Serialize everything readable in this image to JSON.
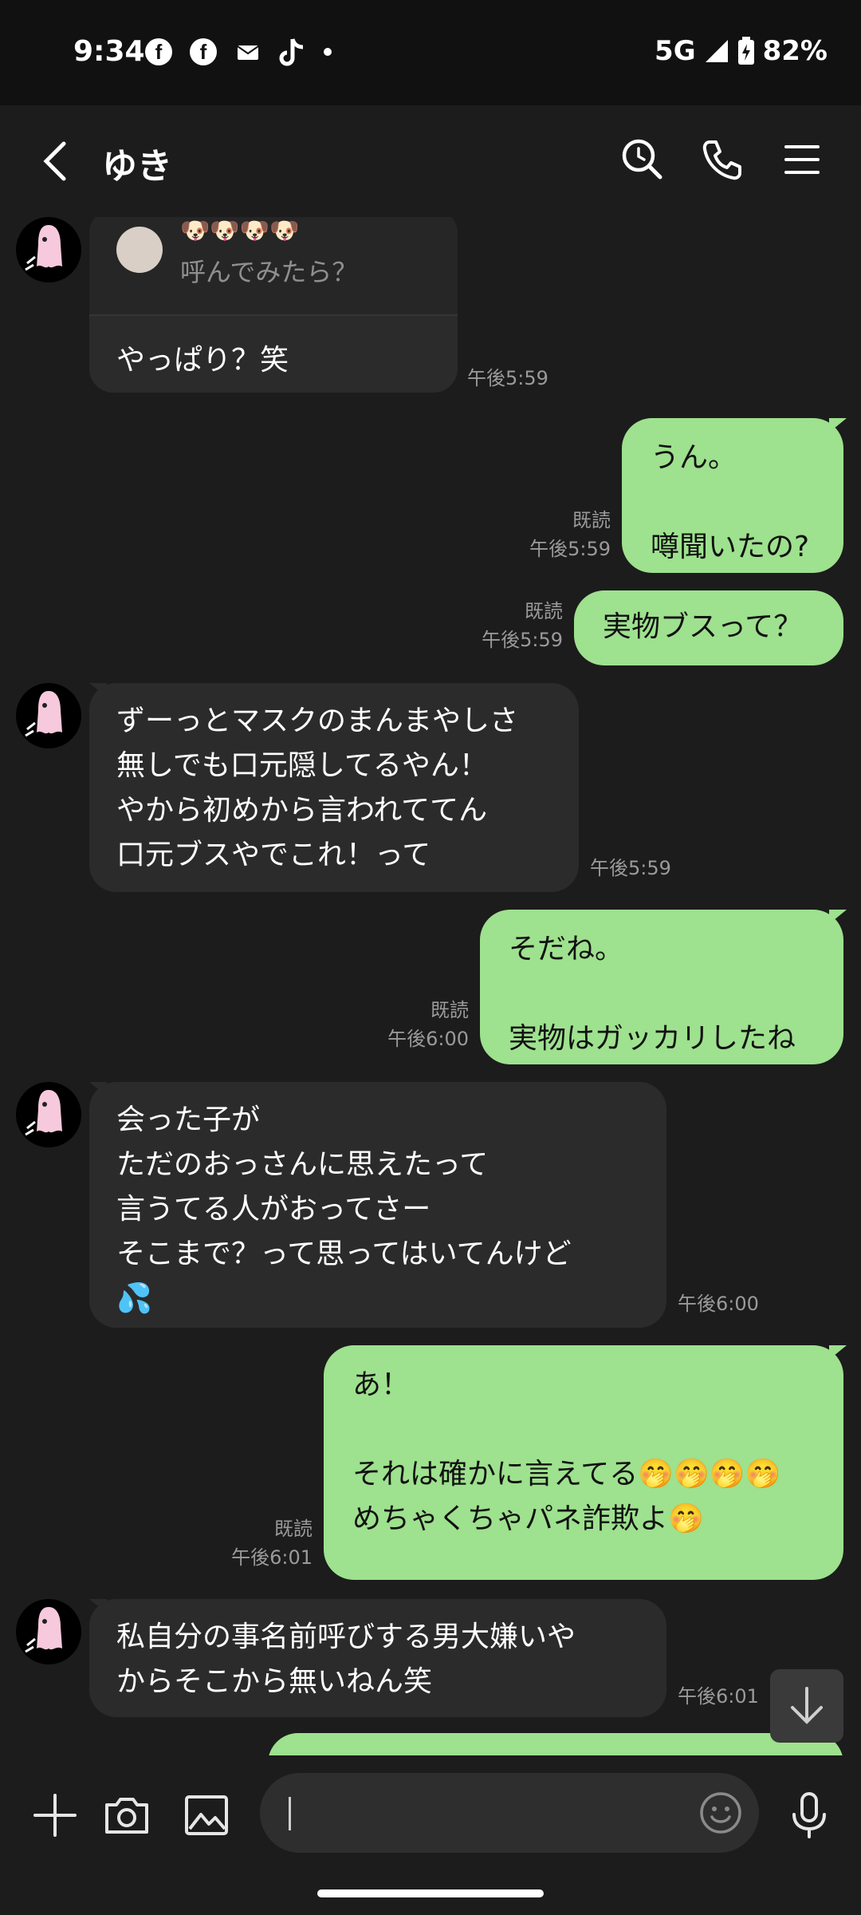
{
  "status_bar": {
    "time": "9:34",
    "network": "5G",
    "battery": "82%",
    "notification_icons": [
      "facebook-icon",
      "facebook-icon",
      "mail-icon",
      "tiktok-icon"
    ]
  },
  "header": {
    "title": "ゆき",
    "icons": [
      "back-icon",
      "search-icon",
      "phone-icon",
      "menu-icon"
    ]
  },
  "messages": [
    {
      "side": "in",
      "reply": {
        "emoji": "🐶🐶🐶🐶",
        "quote": "呼んでみたら？"
      },
      "text": "やっぱり？笑",
      "time": "午後5:59"
    },
    {
      "side": "out",
      "text": "うん。\n\n噂聞いたの?",
      "read": "既読",
      "time": "午後5:59"
    },
    {
      "side": "out",
      "text": "実物ブスって？",
      "read": "既読",
      "time": "午後5:59"
    },
    {
      "side": "in",
      "text": "ずーっとマスクのまんまやしさ\n無しでも口元隠してるやん！\nやから初めから言われててん\n口元ブスやでこれ！って",
      "time": "午後5:59"
    },
    {
      "side": "out",
      "text": "そだね。\n\n実物はガッカリしたね",
      "read": "既読",
      "time": "午後6:00"
    },
    {
      "side": "in",
      "text": "会った子が\nただのおっさんに思えたって\n言うてる人がおってさー\nそこまで？って思ってはいてんけど\n💦",
      "time": "午後6:00"
    },
    {
      "side": "out",
      "text": "あ！\n\nそれは確かに言えてる🤭🤭🤭🤭\nめちゃくちゃパネ詐欺よ🤭",
      "read": "既読",
      "time": "午後6:01"
    },
    {
      "side": "in",
      "text": "私自分の事名前呼びする男大嫌いや\nからそこから無いねん笑",
      "time": "午後6:01"
    }
  ],
  "input": {
    "placeholder": ""
  },
  "colors": {
    "background": "#1c1c1c",
    "incoming_bubble": "#2b2b2b",
    "outgoing_bubble": "#9ee18e",
    "meta_text": "#9a9a9a"
  }
}
